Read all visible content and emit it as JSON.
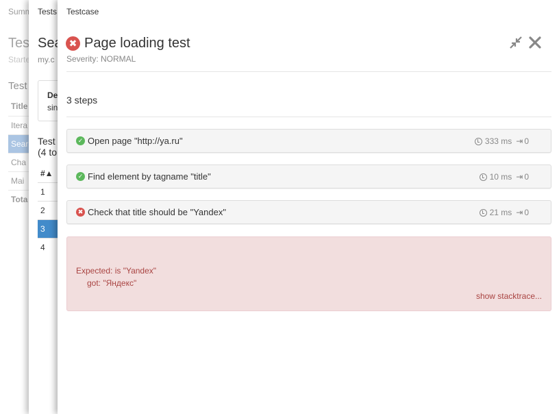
{
  "summary_layer": {
    "nav_label": "Summ",
    "title": "Tes",
    "subtitle": "Starte",
    "section": "Test",
    "rows": [
      "Title",
      "Itera",
      "Sear",
      "Cha",
      "Mai",
      "Tota"
    ]
  },
  "suite_layer": {
    "nav_label": "Tests",
    "title": "Sea",
    "subtitle": "my.c",
    "desc_label": "De",
    "desc_value": "sin",
    "tests_label_1": "Test",
    "tests_label_2": "(4 to",
    "col_hash": "#▲",
    "rows": [
      "1",
      "2",
      "3",
      "4"
    ],
    "selected_color": "#428bca"
  },
  "testcase": {
    "nav_label": "Testcase",
    "title": "Page loading test",
    "severity": "Severity: NORMAL",
    "status_icon": "fail-icon",
    "actions": {
      "collapse_icon": "compress-icon",
      "close_icon": "close-icon"
    },
    "steps_title": "3 steps",
    "steps": [
      {
        "name": "Open page \"http://ya.ru\"",
        "status": "passed",
        "time": "333 ms",
        "attachments": "0"
      },
      {
        "name": "Find element by tagname \"title\"",
        "status": "passed",
        "time": "10 ms",
        "attachments": "0"
      },
      {
        "name": "Check that title should be \"Yandex\"",
        "status": "failed",
        "time": "21 ms",
        "attachments": "0"
      }
    ],
    "error": {
      "line1": "Expected: is \"Yandex\"",
      "line2": "got: \"Яндекс\"",
      "stacktrace_link": "show stacktrace..."
    }
  },
  "colors": {
    "passed": "#5cb85c",
    "failed": "#d9534f",
    "error_bg": "#f2dede",
    "error_text": "#a94442"
  }
}
